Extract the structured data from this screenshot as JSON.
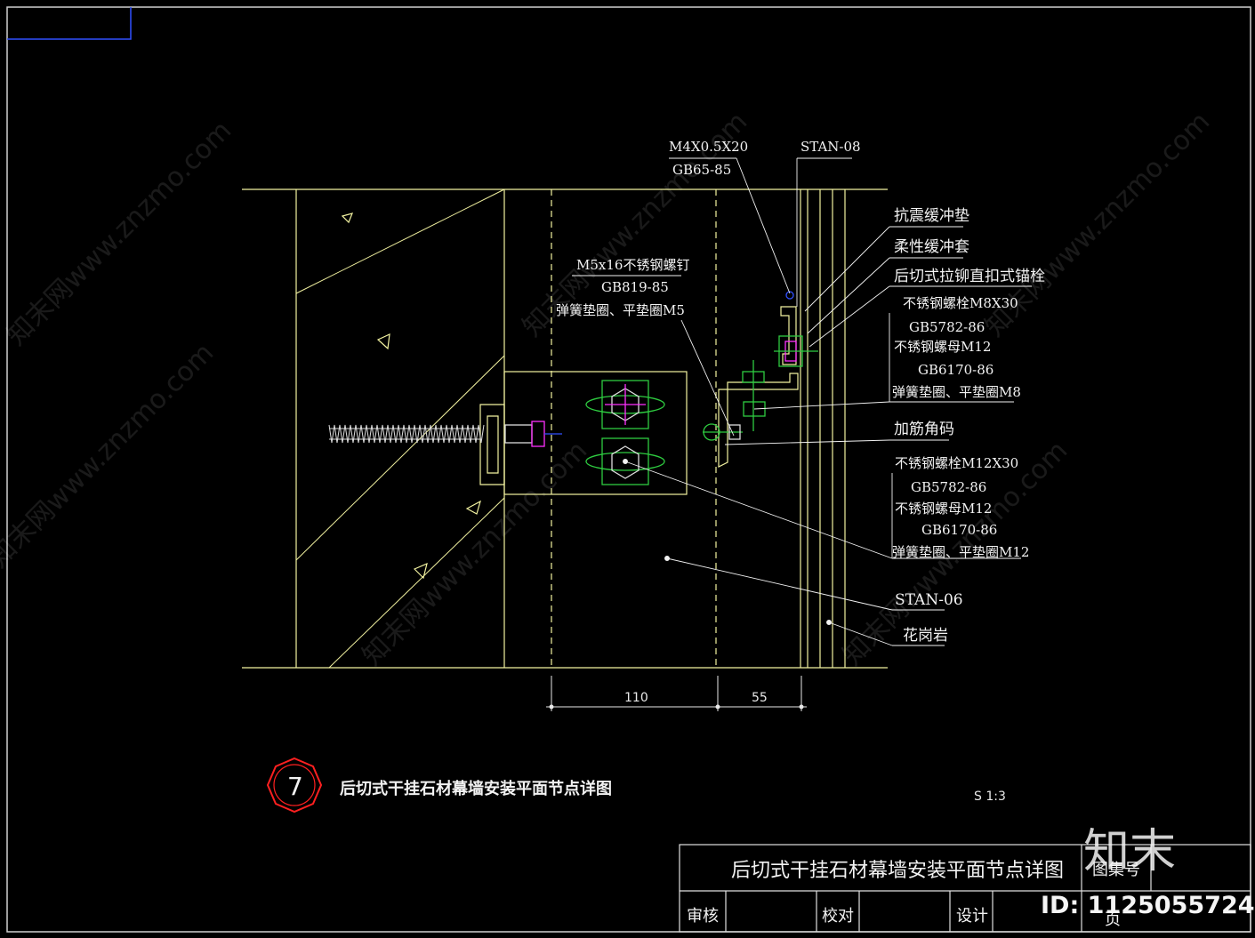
{
  "labels": {
    "m4": "M4X0.5X20",
    "gb65": "GB65-85",
    "stan08": "STAN-08",
    "m5": "M5x16不锈钢螺钉",
    "gb819": "GB819-85",
    "washer_m5": "弹簧垫圈、平垫圈M5",
    "anti_quake": "抗震缓冲垫",
    "flex_sleeve": "柔性缓冲套",
    "anchor": "后切式拉铆直扣式锚栓",
    "bolt_m8": "不锈钢螺栓M8X30",
    "gb5782_a": "GB5782-86",
    "nut_m12_a": "不锈钢螺母M12",
    "gb6170_a": "GB6170-86",
    "washer_m8": "弹簧垫圈、平垫圈M8",
    "angle": "加筋角码",
    "bolt_m12": "不锈钢螺栓M12X30",
    "gb5782_b": "GB5782-86",
    "nut_m12_b": "不锈钢螺母M12",
    "gb6170_b": "GB6170-86",
    "washer_m12": "弹簧垫圈、平垫圈M12",
    "stan06": "STAN-06",
    "granite": "花岗岩"
  },
  "dimensions": {
    "d1": "110",
    "d2": "55"
  },
  "detail": {
    "number": "7",
    "title": "后切式干挂石材幕墙安装平面节点详图",
    "scale": "S 1:3"
  },
  "title_block": {
    "drawing_name": "后切式干挂石材幕墙安装平面节点详图",
    "atlas_no": "图集号",
    "review": "审核",
    "check": "校对",
    "design": "设计",
    "page": "页"
  },
  "watermark": {
    "site": "知末网www.znzmo.com",
    "brand": "知末",
    "id": "ID: 1125055724"
  },
  "colors": {
    "outline": "#f2f2a0",
    "bolt_green": "#2ecc40",
    "highlight_magenta": "#ff30ff",
    "blue": "#3050ff",
    "detail_red": "#ff2020"
  }
}
